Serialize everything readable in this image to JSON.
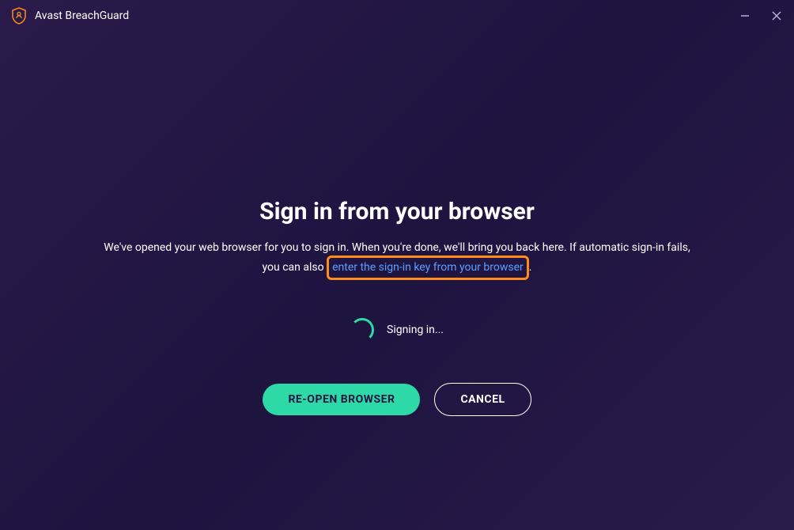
{
  "titlebar": {
    "app_name": "Avast BreachGuard"
  },
  "main": {
    "heading": "Sign in from your browser",
    "description_part1": "We've opened your web browser for you to sign in. When you're done, we'll bring you back here. If automatic sign-in fails, you can also ",
    "link_text": "enter the sign-in key from your browser",
    "description_part2": ".",
    "status_text": "Signing in...",
    "reopen_button": "RE-OPEN BROWSER",
    "cancel_button": "CANCEL"
  },
  "colors": {
    "accent_green": "#2ed9a8",
    "accent_orange": "#ff8c1a",
    "link_blue": "#5c9eff",
    "bg_purple_dark": "#1e1440",
    "bg_purple": "#2a1a4a"
  }
}
